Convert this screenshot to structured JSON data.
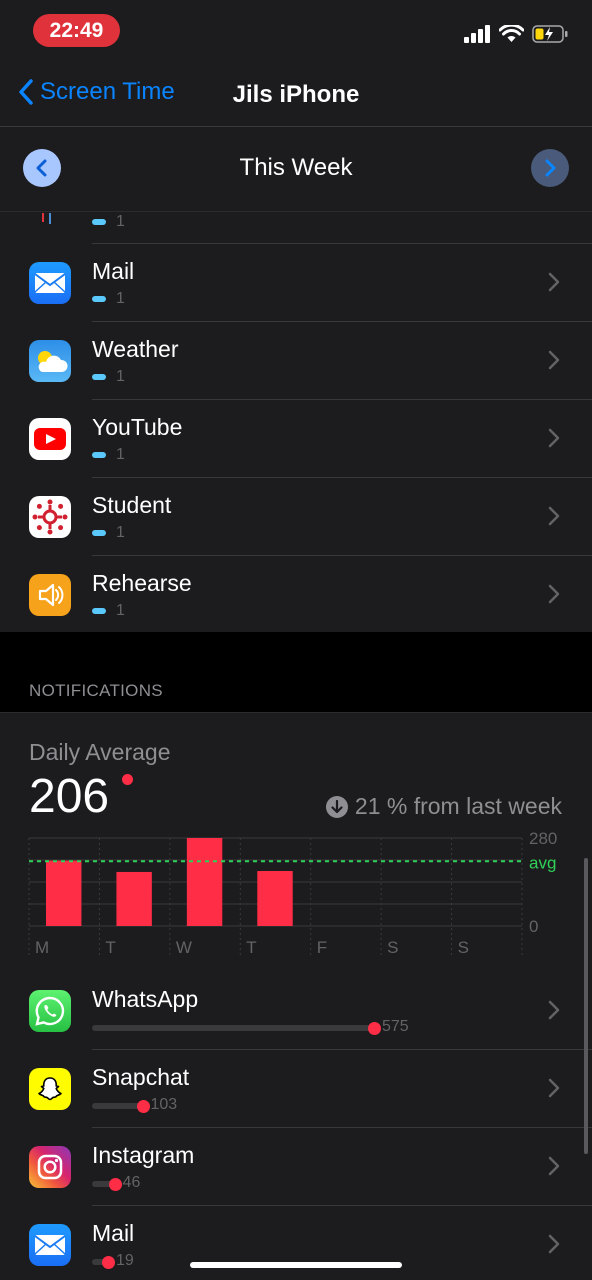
{
  "status_bar": {
    "time": "22:49"
  },
  "nav": {
    "back_label": "Screen Time",
    "title": "Jils iPhone"
  },
  "week": {
    "label": "This Week"
  },
  "partial_row": {
    "count": "1"
  },
  "apps": [
    {
      "name": "Mail",
      "count": "1",
      "icon": "mail-icon"
    },
    {
      "name": "Weather",
      "count": "1",
      "icon": "weather-icon"
    },
    {
      "name": "YouTube",
      "count": "1",
      "icon": "youtube-icon"
    },
    {
      "name": "Student",
      "count": "1",
      "icon": "student-icon"
    },
    {
      "name": "Rehearse",
      "count": "1",
      "icon": "rehearse-icon"
    }
  ],
  "notifications": {
    "section_title": "NOTIFICATIONS",
    "daily_average_label": "Daily Average",
    "daily_average_value": "206",
    "trend_text": "21 % from last week"
  },
  "chart_data": {
    "type": "bar",
    "categories": [
      "M",
      "T",
      "W",
      "T",
      "F",
      "S",
      "S"
    ],
    "values": [
      208,
      172,
      280,
      175,
      null,
      null,
      null
    ],
    "ylim": [
      0,
      280
    ],
    "ytick_labels": [
      "280",
      "0"
    ],
    "average": 206,
    "average_label": "avg",
    "bar_color": "#ff2d46",
    "average_color": "#30d158",
    "grid": true
  },
  "notif_apps": [
    {
      "name": "WhatsApp",
      "count": 575,
      "icon": "whatsapp-icon"
    },
    {
      "name": "Snapchat",
      "count": 103,
      "icon": "snapchat-icon"
    },
    {
      "name": "Instagram",
      "count": 46,
      "icon": "instagram-icon"
    },
    {
      "name": "Mail",
      "count": 19,
      "icon": "mail-icon"
    }
  ]
}
